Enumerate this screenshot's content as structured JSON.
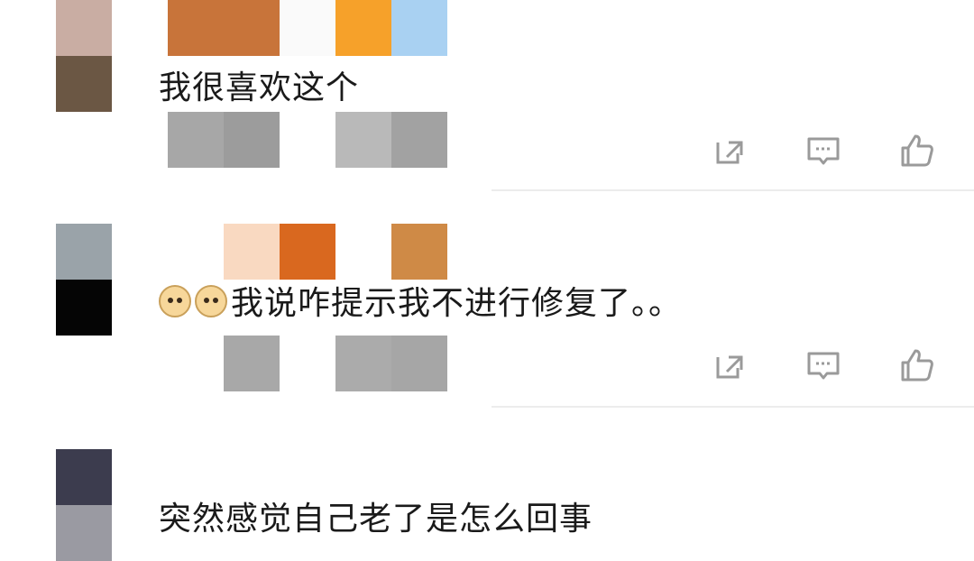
{
  "comments": [
    {
      "text": "我很喜欢这个",
      "emoji_count": 0,
      "actions": [
        {
          "icon": "share-icon"
        },
        {
          "icon": "reply-icon"
        },
        {
          "icon": "like-icon"
        }
      ]
    },
    {
      "text": "我说咋提示我不进行修复了。。",
      "emoji_count": 2,
      "emoji": "doge-emoji",
      "actions": [
        {
          "icon": "share-icon"
        },
        {
          "icon": "reply-icon"
        },
        {
          "icon": "like-icon"
        }
      ]
    },
    {
      "text": "突然感觉自己老了是怎么回事",
      "emoji_count": 0
    }
  ],
  "colors": {
    "text": "#1a1a1a",
    "icon": "#9a9a9a",
    "divider": "#ececec"
  }
}
